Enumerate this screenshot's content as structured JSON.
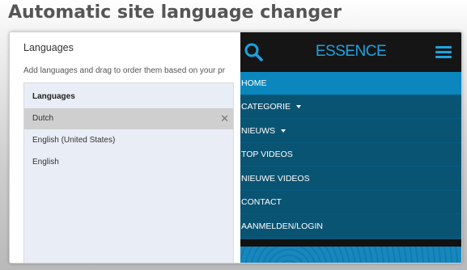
{
  "heading": "Automatic site language changer",
  "settings": {
    "title": "Languages",
    "description": "Add languages and drag to order them based on your pr",
    "list_header": "Languages",
    "languages": [
      {
        "label": "Dutch",
        "selected": true,
        "remove_glyph": "✕"
      },
      {
        "label": "English (United States)",
        "selected": false
      },
      {
        "label": "English",
        "selected": false
      }
    ]
  },
  "preview": {
    "logo": "ESSENCE",
    "accent_color": "#1aa3e2",
    "menu_background": "#0a5473",
    "active_color": "#0b87bd",
    "icons": {
      "search": "search-icon",
      "menu": "hamburger-menu-icon",
      "dropdown": "caret-down-icon"
    },
    "menu_items": [
      {
        "label": "HOME",
        "active": true,
        "dropdown": false
      },
      {
        "label": "CATEGORIE",
        "active": false,
        "dropdown": true
      },
      {
        "label": "NIEUWS",
        "active": false,
        "dropdown": true
      },
      {
        "label": "TOP VIDEOS",
        "active": false,
        "dropdown": false
      },
      {
        "label": "NIEUWE VIDEOS",
        "active": false,
        "dropdown": false
      },
      {
        "label": "CONTACT",
        "active": false,
        "dropdown": false
      },
      {
        "label": "AANMELDEN/LOGIN",
        "active": false,
        "dropdown": false
      }
    ]
  }
}
